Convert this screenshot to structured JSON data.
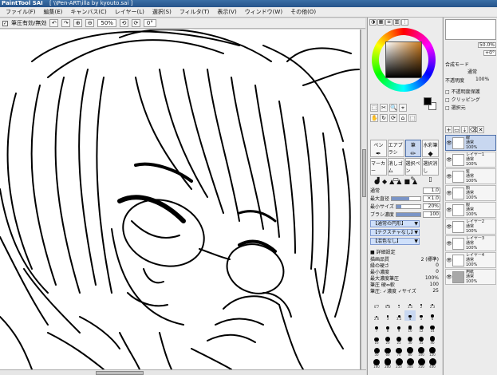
{
  "window": {
    "app_name": "PaintTool SAI",
    "file_path": "[ \\\\Pen-ART\\illa by kyouto.sai ]"
  },
  "menu": [
    "ファイル(F)",
    "編集(E)",
    "キャンバス(C)",
    "レイヤー(L)",
    "選択(S)",
    "フィルタ(T)",
    "表示(V)",
    "ウィンドウ(W)",
    "その他(O)"
  ],
  "toolbar": {
    "check_label": "✓",
    "option_label": "筆圧有効/無効",
    "zoom": "50%",
    "rotation": "0°",
    "buttons": [
      "↶",
      "↷",
      "⊕",
      "⊖",
      "⟲",
      "⟳"
    ]
  },
  "tool_panel": {
    "tabs": [
      "◑",
      "▦",
      "≡",
      "▥",
      "⋮"
    ],
    "tool_row": [
      "⬚",
      "✂",
      "🔍",
      "⌖",
      "✋",
      "↻",
      "⟳",
      "⌂",
      "⬚"
    ],
    "tools": [
      {
        "label": "ペン",
        "glyph": "✒"
      },
      {
        "label": "エアブラシ",
        "glyph": "◌"
      },
      {
        "label": "筆",
        "glyph": "✏"
      },
      {
        "label": "水彩筆",
        "glyph": "◆"
      },
      {
        "label": "マーカー",
        "glyph": "▮"
      },
      {
        "label": "消しゴム",
        "glyph": "▭"
      },
      {
        "label": "選択ペン",
        "glyph": "✎"
      },
      {
        "label": "選択消し",
        "glyph": "▯"
      }
    ],
    "shapes": [
      "●",
      "◆",
      "▲",
      "▲",
      "■",
      "▲"
    ],
    "settings": [
      {
        "label": "通常",
        "value": "1.0"
      },
      {
        "label": "最大直径",
        "value": "×1.0",
        "fill": 0.6
      },
      {
        "label": "最小サイズ",
        "value": "20%",
        "fill": 0.2
      },
      {
        "label": "ブラシ濃度",
        "value": "100",
        "fill": 1.0
      }
    ],
    "dropdowns": [
      "【通常の円形】",
      "【テクスチャなし】",
      "【混色なし】"
    ],
    "section_title": "■ 詳細設定",
    "params": [
      {
        "label": "描画品質",
        "value": "2 (標準)"
      },
      {
        "label": "縁の硬さ",
        "value": "0"
      },
      {
        "label": "最小濃度",
        "value": "0"
      },
      {
        "label": "最大濃度筆圧",
        "value": "100%"
      },
      {
        "label": "筆圧 硬⇔軟",
        "value": "100"
      },
      {
        "label": "筆圧: ✓濃度 ✓サイズ",
        "value": "25"
      }
    ],
    "brush_sizes": [
      "0.7",
      "0.8",
      "1",
      "1.5",
      "2",
      "2.3",
      "2.6",
      "3",
      "3.5",
      "4",
      "5",
      "6",
      "7",
      "8",
      "9",
      "10",
      "12",
      "14",
      "16",
      "20",
      "25",
      "30",
      "35",
      "40",
      "50",
      "60",
      "70",
      "80",
      "100",
      "120",
      "160",
      "200",
      "250",
      "300",
      "350",
      "400"
    ]
  },
  "layer_panel": {
    "zoom": "50.0%",
    "angle": "+0°",
    "mode_label": "合成モード",
    "mode_value": "通常",
    "opacity_label": "不透明度",
    "opacity_value": "100%",
    "options": [
      "□ 不透明度保護",
      "□ クリッピング",
      "□ 選択元"
    ],
    "layers": [
      {
        "name": "線",
        "mode": "通常",
        "opacity": "100%",
        "selected": true,
        "gray": false
      },
      {
        "name": "レイヤー1",
        "mode": "通常",
        "opacity": "100%",
        "selected": false,
        "gray": false
      },
      {
        "name": "髪",
        "mode": "通常",
        "opacity": "100%",
        "selected": false,
        "gray": false
      },
      {
        "name": "顔",
        "mode": "通常",
        "opacity": "100%",
        "selected": false,
        "gray": false
      },
      {
        "name": "服",
        "mode": "通常",
        "opacity": "100%",
        "selected": false,
        "gray": false
      },
      {
        "name": "レイヤー2",
        "mode": "通常",
        "opacity": "100%",
        "selected": false,
        "gray": false
      },
      {
        "name": "レイヤー3",
        "mode": "通常",
        "opacity": "100%",
        "selected": false,
        "gray": false
      },
      {
        "name": "レイヤー4",
        "mode": "通常",
        "opacity": "100%",
        "selected": false,
        "gray": false
      },
      {
        "name": "用紙",
        "mode": "通常",
        "opacity": "100%",
        "selected": false,
        "gray": true
      }
    ]
  },
  "colors": {
    "current_fg": "#000000",
    "current_bg": "#ffffff",
    "selection": "#c8d7f0",
    "hue": "#c97a1e"
  }
}
